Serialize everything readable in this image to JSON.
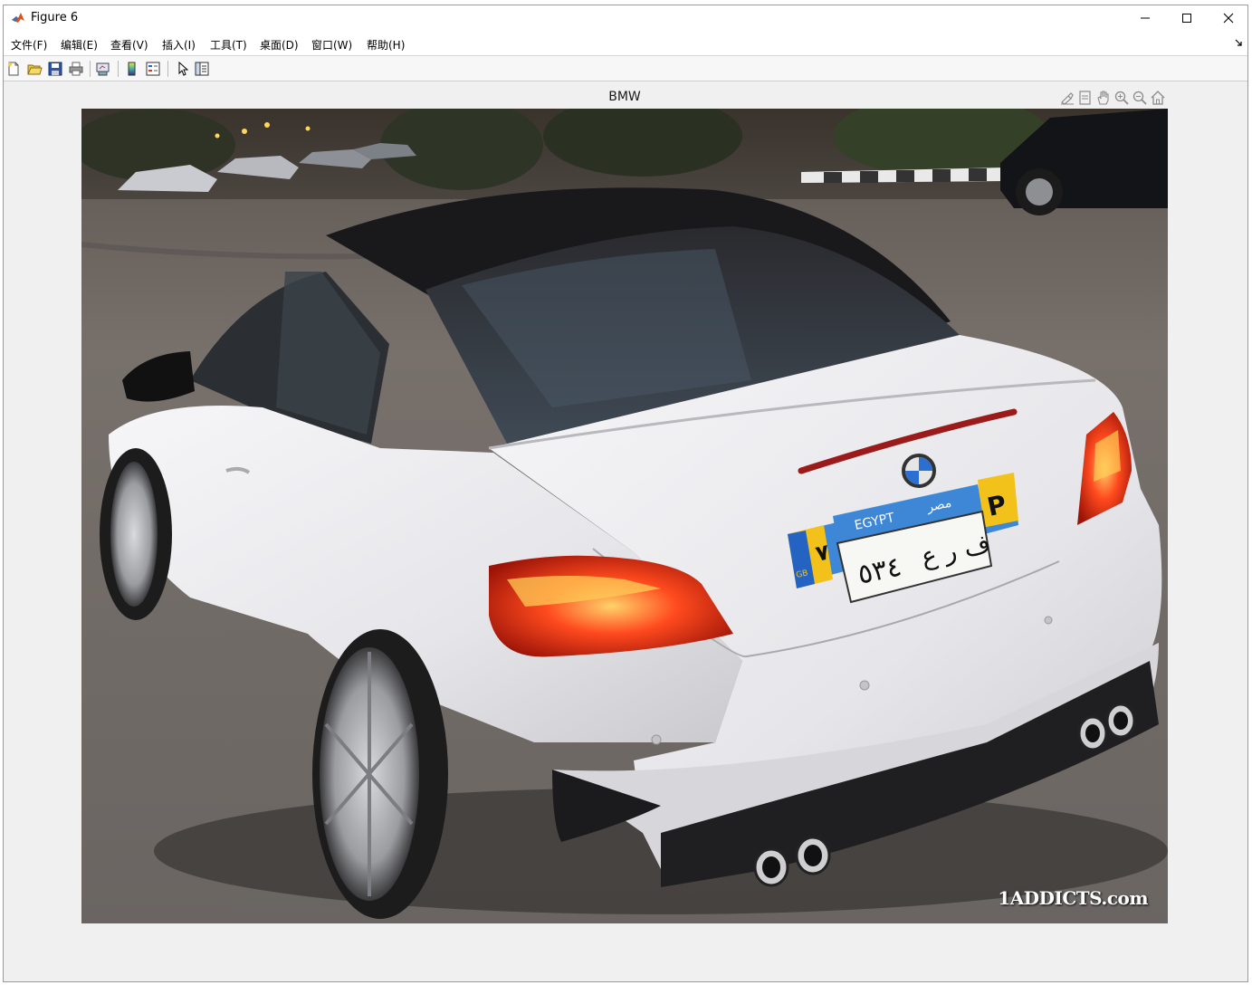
{
  "window": {
    "title": "Figure 6",
    "app_icon": "matlab-icon",
    "controls": [
      "minimize-icon",
      "maximize-icon",
      "close-icon"
    ]
  },
  "menu": {
    "items": [
      {
        "label": "文件(F)"
      },
      {
        "label": "编辑(E)"
      },
      {
        "label": "查看(V)"
      },
      {
        "label": "插入(I)"
      },
      {
        "label": "工具(T)"
      },
      {
        "label": "桌面(D)"
      },
      {
        "label": "窗口(W)"
      },
      {
        "label": "帮助(H)"
      }
    ]
  },
  "toolbar": {
    "icons": [
      "new-figure-icon",
      "open-file-icon",
      "save-icon",
      "print-icon",
      "link-plot-icon",
      "insert-colorbar-icon",
      "insert-legend-icon",
      "edit-plot-icon",
      "property-inspector-icon"
    ]
  },
  "axes": {
    "title": "BMW",
    "toolbar_icons": [
      "brush-icon",
      "data-tips-icon",
      "pan-icon",
      "zoom-in-icon",
      "zoom-out-icon",
      "home-icon"
    ]
  },
  "image": {
    "watermark": "1ADDICTS.com",
    "plate": {
      "country": "EGYPT",
      "country_arabic": "مصر",
      "number_arabic": "٥٣٤",
      "letters_arabic": "ف ر ع",
      "side_letter": "P",
      "side_number": "٧",
      "eu_code": "GB"
    },
    "colors": {
      "car_body": "#e9e9ec",
      "roof": "#1b1b1e",
      "tail_light": "#ff3b1a",
      "plate_blue": "#3e86d6",
      "plate_yellow": "#f2c21a",
      "ground": "#6e6966"
    }
  }
}
